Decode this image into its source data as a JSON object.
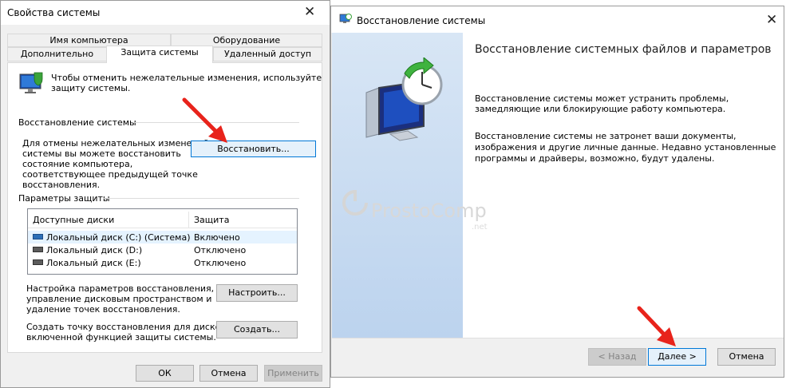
{
  "left_window": {
    "title": "Свойства системы",
    "close_glyph": "✕",
    "tabs_row1": [
      "Имя компьютера",
      "Оборудование"
    ],
    "tabs_row2": [
      "Дополнительно",
      "Защита системы",
      "Удаленный доступ"
    ],
    "intro_line1": "Чтобы отменить нежелательные изменения, используйте",
    "intro_line2": "защиту системы.",
    "restore_group_title": "Восстановление системы",
    "restore_desc": [
      "Для отмены нежелательных изменений",
      "системы вы можете восстановить",
      "состояние компьютера,",
      "соответствующее предыдущей точке",
      "восстановления."
    ],
    "restore_button": "Восстановить...",
    "protection_group_title": "Параметры защиты",
    "table": {
      "headers": [
        "Доступные диски",
        "Защита"
      ],
      "rows": [
        {
          "disk": "Локальный диск (C:) (Система)",
          "status": "Включено",
          "icon": "system-disk-icon"
        },
        {
          "disk": "Локальный диск (D:)",
          "status": "Отключено",
          "icon": "disk-icon"
        },
        {
          "disk": "Локальный диск (E:)",
          "status": "Отключено",
          "icon": "disk-icon"
        }
      ]
    },
    "configure_desc": [
      "Настройка параметров восстановления,",
      "управление дисковым пространством и",
      "удаление точек восстановления."
    ],
    "configure_button": "Настроить...",
    "create_desc": [
      "Создать точку восстановления для дисков с",
      "включенной функцией защиты системы."
    ],
    "create_button": "Создать...",
    "ok_button": "ОК",
    "cancel_button": "Отмена",
    "apply_button": "Применить"
  },
  "right_window": {
    "title": "Восстановление системы",
    "close_glyph": "✕",
    "heading": "Восстановление системных файлов и параметров",
    "para1": [
      "Восстановление системы может устранить проблемы,",
      "замедляющие или блокирующие работу компьютера."
    ],
    "para2": [
      "Восстановление системы не затронет ваши документы,",
      "изображения и другие личные данные. Недавно установленные",
      "программы и драйверы, возможно, будут удалены."
    ],
    "watermark": "ProstoComp",
    "watermark_sub": ".net",
    "back_button": "< Назад",
    "next_button": "Далее >",
    "cancel_button": "Отмена"
  },
  "colors": {
    "accent": "#0078d7",
    "arrow_red": "#e8231b",
    "banner_blue": "#cfdff1"
  }
}
